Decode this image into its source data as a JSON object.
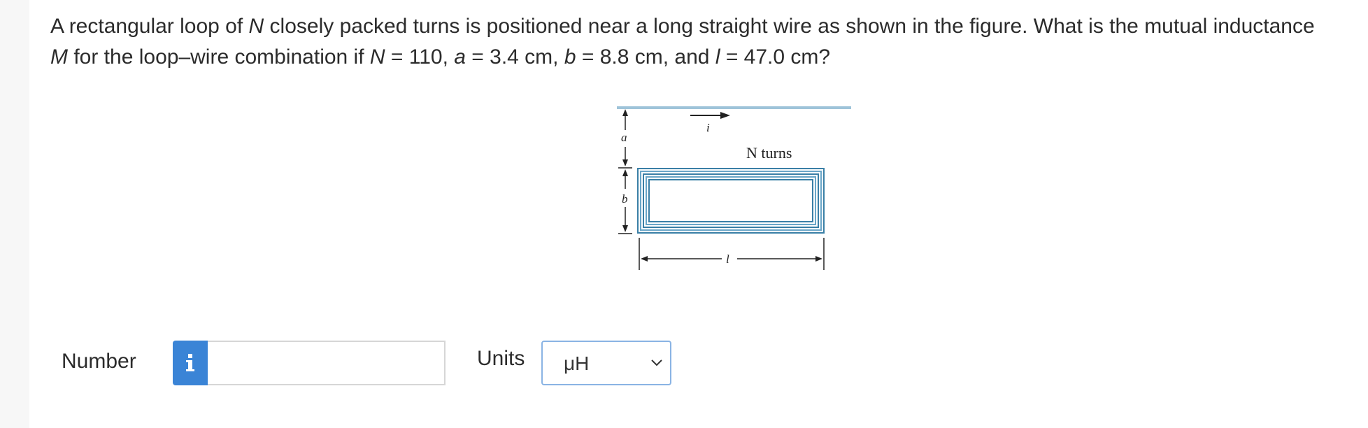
{
  "question": {
    "p1": "A rectangular loop of ",
    "v1": "N",
    "p2": " closely packed turns is positioned near a long straight wire as shown in the figure. What is the mutual inductance ",
    "v2": "M",
    "p3": " for the loop–wire combination if ",
    "v3": "N",
    "p4": " = 110, ",
    "v4": "a",
    "p5": " = 3.4 cm, ",
    "v5": "b",
    "p6": " = 8.8 cm, and ",
    "v6": "l",
    "p7": " = 47.0 cm?"
  },
  "figure": {
    "label_a": "a",
    "label_b": "b",
    "label_i": "i",
    "label_l": "l",
    "label_turns": "N turns"
  },
  "answer": {
    "number_label": "Number",
    "info_icon_text": "i",
    "number_value": "",
    "units_label": "Units",
    "units_selected": "μH"
  },
  "colors": {
    "wire": "#9ec3d9",
    "coil": "#3a7fa6",
    "info_button": "#3a84d6",
    "select_border": "#8ab4e4"
  },
  "icons": {
    "info": "info-icon",
    "dropdown": "chevron-down-icon"
  }
}
